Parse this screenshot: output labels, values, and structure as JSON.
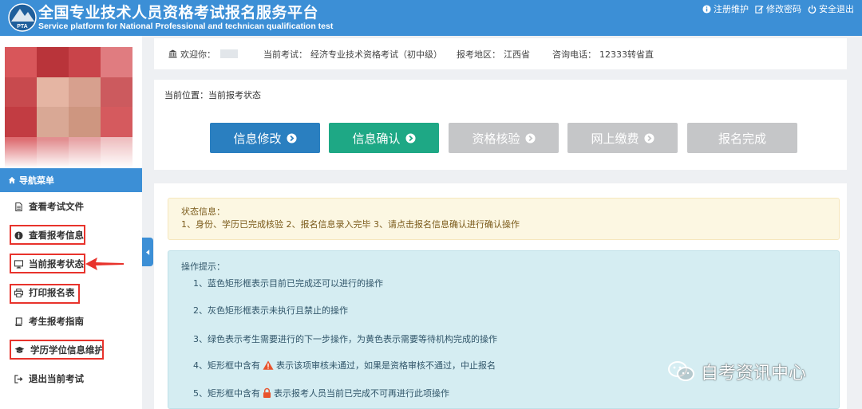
{
  "header": {
    "logo_text": "PTA",
    "title": "全国专业技术人员资格考试报名服务平台",
    "subtitle": "Service platform for National Professional and technican qualification test",
    "links": [
      {
        "label": "注册维护",
        "icon": "info-circle-icon"
      },
      {
        "label": "修改密码",
        "icon": "edit-icon"
      },
      {
        "label": "安全退出",
        "icon": "power-icon"
      }
    ]
  },
  "colors": {
    "primary": "#3c8fd6",
    "step_blue": "#2a7fc0",
    "step_green": "#1ea885",
    "step_gray": "#c5c6c8",
    "highlight_red": "#e8332c"
  },
  "sidebar": {
    "nav_title": "导航菜单",
    "items": [
      {
        "label": "查看考试文件",
        "icon": "file-icon"
      },
      {
        "label": "查看报考信息",
        "icon": "info-icon"
      },
      {
        "label": "当前报考状态",
        "icon": "monitor-icon"
      },
      {
        "label": "打印报名表",
        "icon": "printer-icon"
      },
      {
        "label": "考生报考指南",
        "icon": "book-icon"
      },
      {
        "label": "学历学位信息维护",
        "icon": "graduation-cap-icon"
      },
      {
        "label": "退出当前考试",
        "icon": "sign-out-icon"
      }
    ]
  },
  "infobar": {
    "welcome_label": "欢迎你：",
    "exam_label": "当前考试：",
    "exam_value": "经济专业技术资格考试（初中级）",
    "region_label": "报考地区：",
    "region_value": "江西省",
    "phone_label": "咨询电话：",
    "phone_value": "12333转省直"
  },
  "steps_panel": {
    "breadcrumb": "当前位置：当前报考状态",
    "steps": [
      {
        "label": "信息修改",
        "state": "done"
      },
      {
        "label": "信息确认",
        "state": "next"
      },
      {
        "label": "资格核验",
        "state": "disabled"
      },
      {
        "label": "网上缴费",
        "state": "disabled"
      },
      {
        "label": "报名完成",
        "state": "disabled"
      }
    ]
  },
  "status": {
    "title": "状态信息：",
    "text": "1、身份、学历已完成核验 2、报名信息录入完毕 3、请点击报名信息确认进行确认操作"
  },
  "tips": {
    "title": "操作提示：",
    "items": [
      "1、蓝色矩形框表示目前已完成还可以进行的操作",
      "2、灰色矩形框表示未执行且禁止的操作",
      "3、绿色表示考生需要进行的下一步操作，为黄色表示需要等待机构完成的操作"
    ],
    "item4_before": "4、矩形框中含有",
    "item4_after": "表示该项审核未通过，如果是资格审核不通过，中止报名",
    "item5_before": "5、矩形框中含有",
    "item5_after": "表示报考人员当前已完成不可再进行此项操作"
  },
  "watermark": "自考资讯中心"
}
